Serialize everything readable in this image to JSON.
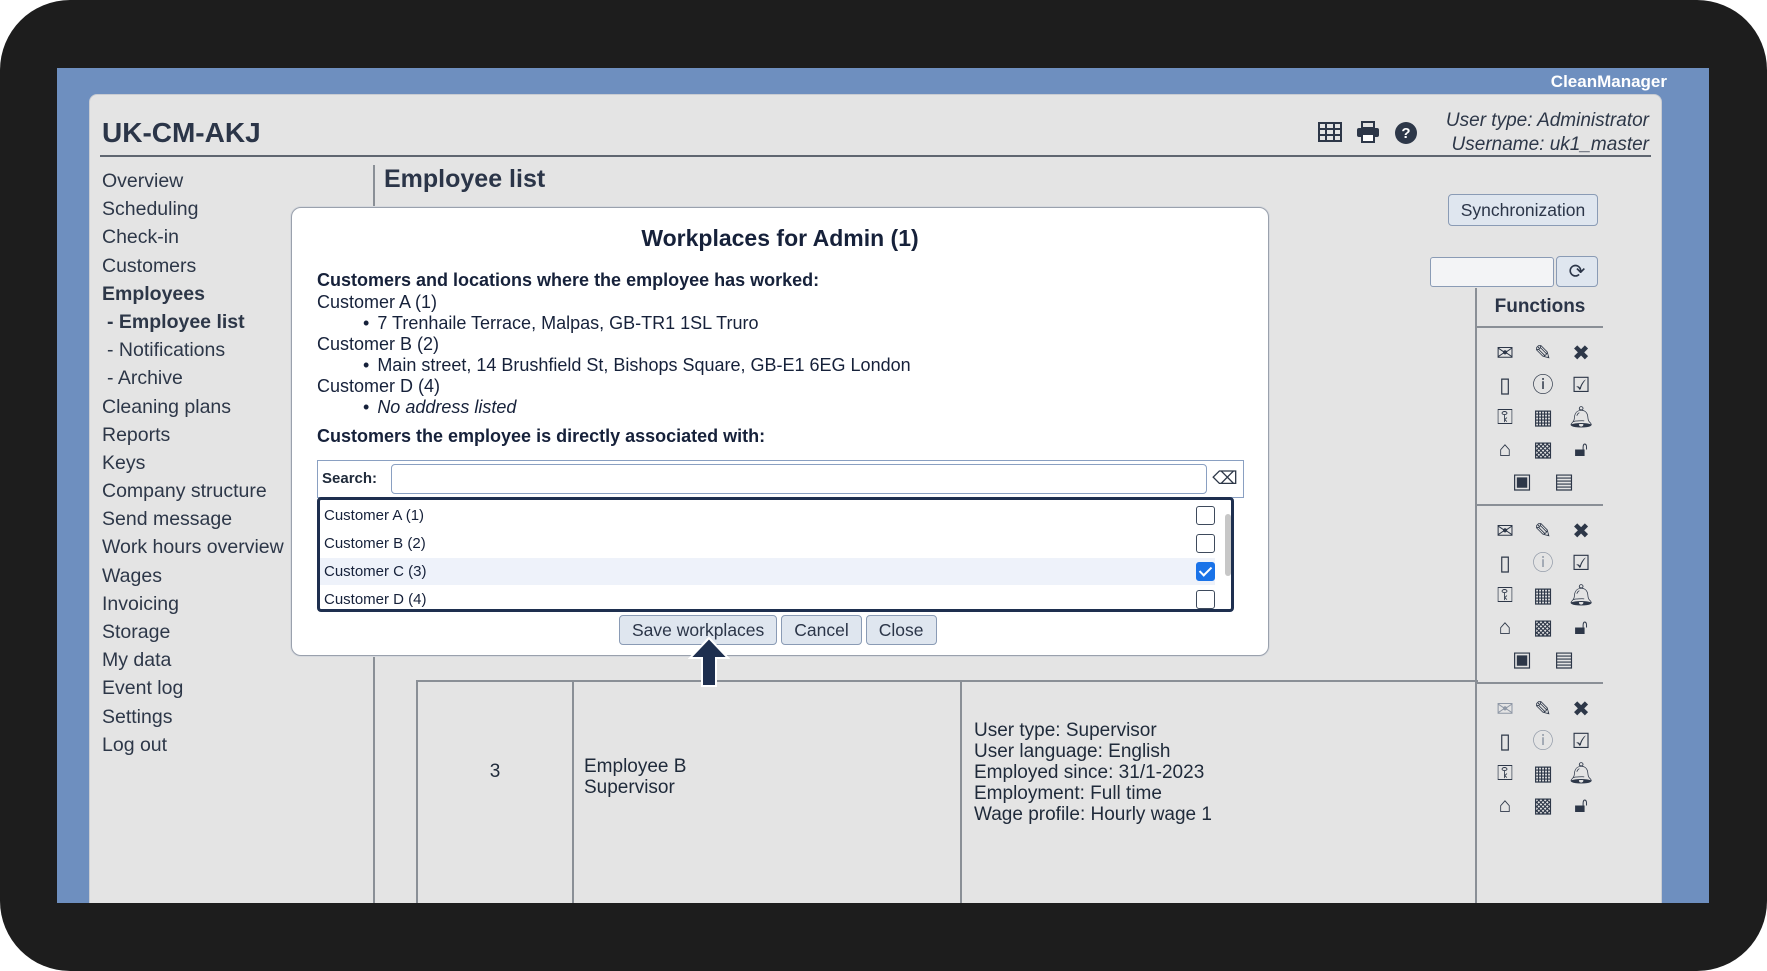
{
  "brand": "CleanManager",
  "app": {
    "title": "UK-CM-AKJ",
    "user_type": "User type: Administrator",
    "username": "Username: uk1_master"
  },
  "nav": {
    "overview": "Overview",
    "scheduling": "Scheduling",
    "checkin": "Check-in",
    "customers": "Customers",
    "employees": "Employees",
    "employee_list": "- Employee list",
    "notifications": "- Notifications",
    "archive": "- Archive",
    "cleaning_plans": "Cleaning plans",
    "reports": "Reports",
    "keys": "Keys",
    "company_structure": "Company structure",
    "send_message": "Send message",
    "work_hours": "Work hours overview",
    "wages": "Wages",
    "invoicing": "Invoicing",
    "storage": "Storage",
    "my_data": "My data",
    "event_log": "Event log",
    "settings": "Settings",
    "logout": "Log out"
  },
  "page": {
    "title": "Employee list",
    "sync_label": "Synchronization",
    "functions_header": "Functions"
  },
  "row3": {
    "id": "3",
    "name": "Employee B",
    "role": "Supervisor",
    "user_type": "User type: Supervisor",
    "language": "User language: English",
    "employed": "Employed since: 31/1-2023",
    "employment": "Employment: Full time",
    "wage": "Wage profile: Hourly wage 1"
  },
  "dialog": {
    "title": "Workplaces for Admin (1)",
    "worked_heading": "Customers and locations where the employee has worked:",
    "customers_worked": [
      {
        "name": "Customer A (1)",
        "address": "7 Trenhaile Terrace, Malpas, GB-TR1 1SL Truro"
      },
      {
        "name": "Customer B (2)",
        "address": "Main street, 14 Brushfield St, Bishops Square, GB-E1 6EG London"
      },
      {
        "name": "Customer D (4)",
        "address": "No address listed"
      }
    ],
    "associated_heading": "Customers the employee is directly associated with:",
    "search_label": "Search:",
    "list": [
      {
        "name": "Customer A (1)",
        "checked": false
      },
      {
        "name": "Customer B (2)",
        "checked": false
      },
      {
        "name": "Customer C (3)",
        "checked": true
      },
      {
        "name": "Customer D (4)",
        "checked": false
      }
    ],
    "save_label": "Save workplaces",
    "cancel_label": "Cancel",
    "close_label": "Close"
  },
  "icons": {
    "toolbar": [
      "table-icon",
      "print-icon",
      "help-icon"
    ],
    "functions": [
      "mail-icon",
      "edit-icon",
      "delete-icon",
      "book-icon",
      "info-icon",
      "checklist-icon",
      "key-icon",
      "calendar-icon",
      "bell-icon",
      "home-icon",
      "qr-code-icon",
      "lock-icon",
      "id-card-icon",
      "documents-icon"
    ]
  }
}
